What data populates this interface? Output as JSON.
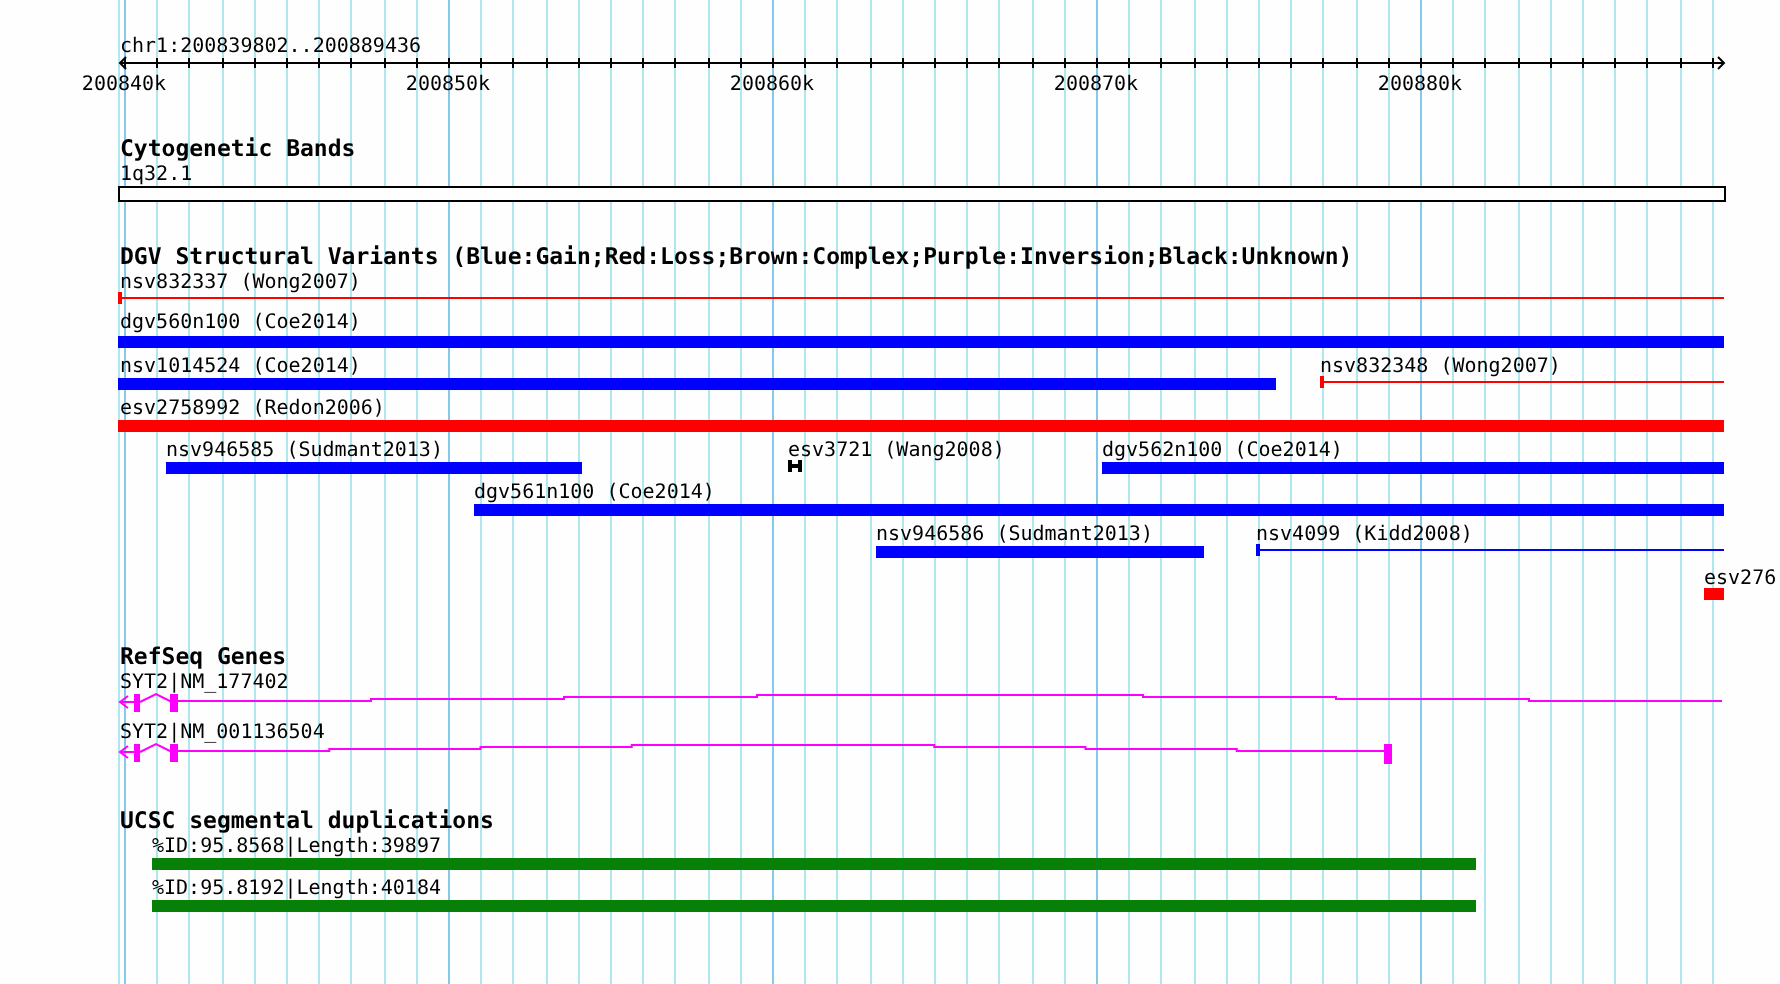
{
  "ruler": {
    "location": "chr1:200839802..200889436",
    "ticks": [
      "200840k",
      "200850k",
      "200860k",
      "200870k",
      "200880k"
    ]
  },
  "tracks": [
    {
      "title": "Cytogenetic Bands",
      "features": [
        {
          "label": "1q32.1",
          "kind": "band"
        }
      ]
    },
    {
      "title": "DGV Structural Variants (Blue:Gain;Red:Loss;Brown:Complex;Purple:Inversion;Black:Unknown)",
      "features": [
        {
          "label": "nsv832337 (Wong2007)",
          "kind": "thin",
          "color": "#ff0000"
        },
        {
          "label": "dgv560n100 (Coe2014)",
          "kind": "bar",
          "color": "#0000ff"
        },
        {
          "label": "nsv1014524 (Coe2014)",
          "kind": "bar",
          "color": "#0000ff"
        },
        {
          "label": "nsv832348 (Wong2007)",
          "kind": "thin",
          "color": "#ff0000"
        },
        {
          "label": "esv2758992 (Redon2006)",
          "kind": "bar",
          "color": "#ff0000"
        },
        {
          "label": "nsv946585 (Sudmant2013)",
          "kind": "bar",
          "color": "#0000ff"
        },
        {
          "label": "esv3721 (Wang2008)",
          "kind": "point",
          "color": "#000000"
        },
        {
          "label": "dgv562n100 (Coe2014)",
          "kind": "bar",
          "color": "#0000ff"
        },
        {
          "label": "dgv561n100 (Coe2014)",
          "kind": "bar",
          "color": "#0000ff"
        },
        {
          "label": "nsv946586 (Sudmant2013)",
          "kind": "bar",
          "color": "#0000ff"
        },
        {
          "label": "nsv4099 (Kidd2008)",
          "kind": "thin",
          "color": "#0000ff"
        },
        {
          "label": "esv276",
          "kind": "bar",
          "color": "#ff0000"
        }
      ]
    },
    {
      "title": "RefSeq Genes",
      "features": [
        {
          "label": "SYT2|NM_177402",
          "kind": "gene"
        },
        {
          "label": "SYT2|NM_001136504",
          "kind": "gene"
        }
      ]
    },
    {
      "title": "UCSC segmental duplications",
      "features": [
        {
          "label": "%ID:95.8568|Length:39897",
          "kind": "dup"
        },
        {
          "label": "%ID:95.8192|Length:40184",
          "kind": "dup"
        }
      ]
    }
  ]
}
